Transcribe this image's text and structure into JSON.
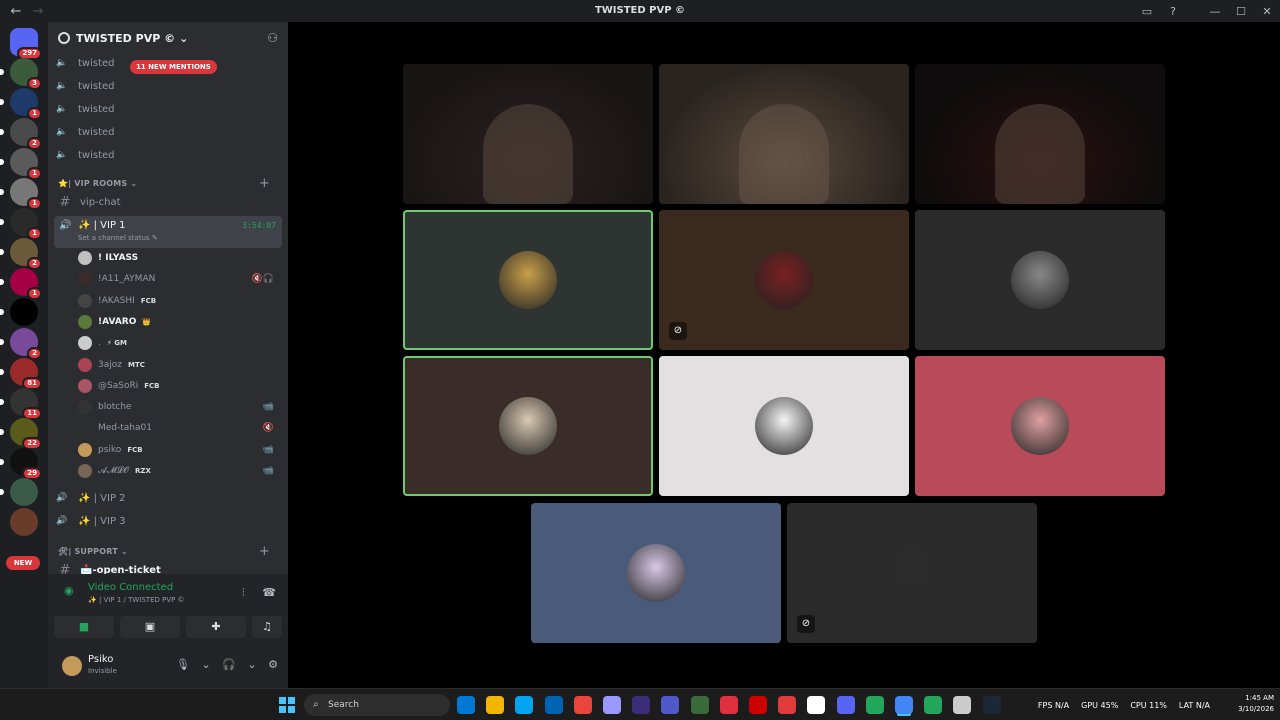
{
  "titlebar": {
    "title": "TWISTED PVP ©",
    "back": "←",
    "forward": "→"
  },
  "guild": {
    "name": "TWISTED PVP ©",
    "chevron": "⌄"
  },
  "servers": [
    {
      "badge": "297",
      "color": "#5865f2"
    },
    {
      "badge": "3",
      "color": "#3b5b3b"
    },
    {
      "badge": "1",
      "color": "#1e3a6a"
    },
    {
      "badge": "2",
      "color": "#4a4a4a"
    },
    {
      "badge": "1",
      "color": "#5a5a5a"
    },
    {
      "badge": "1",
      "color": "#777"
    },
    {
      "badge": "1",
      "color": "#2a2a2a"
    },
    {
      "badge": "2",
      "color": "#6a5a3a"
    },
    {
      "badge": "1",
      "color": "#a50044"
    },
    {
      "badge": "",
      "color": "#000000"
    },
    {
      "badge": "2",
      "color": "#7a4a9a"
    },
    {
      "badge": "81",
      "color": "#9a2a2a"
    },
    {
      "badge": "11",
      "color": "#333"
    },
    {
      "badge": "22",
      "color": "#5a5a1a"
    },
    {
      "badge": "29",
      "color": "#111"
    },
    {
      "badge": "",
      "color": "#3a5a4a"
    },
    {
      "badge": "",
      "color": "#6a3a2a"
    }
  ],
  "new_pill": "NEW",
  "top_voice_channels": [
    "twisted",
    "twisted",
    "twisted",
    "twisted",
    "twisted"
  ],
  "mentions_pill": "11 NEW MENTIONS",
  "categories": {
    "vip": "⭐| VIP ROOMS ⌄",
    "support": "🛠| SUPPORT ⌄"
  },
  "text_channels": {
    "vip_chat": "vip-chat",
    "open_ticket": "📩-open-ticket"
  },
  "vip1": {
    "name": "✨ | VIP 1",
    "timer": "3:54:07",
    "status": "Set a channel status ✎"
  },
  "members": [
    {
      "name": "! ILYASS",
      "tag": "",
      "icon": "",
      "color": "#c0c0c0",
      "bold": true
    },
    {
      "name": "!A11_AYMAN",
      "tag": "",
      "icon": "🔇🎧",
      "color": "#3a2a2a",
      "bold": false
    },
    {
      "name": "!AKASHI",
      "tag": "FCB",
      "icon": "",
      "color": "#444",
      "bold": false
    },
    {
      "name": "!AVARO",
      "tag": "👑",
      "icon": "",
      "color": "#5a7a3a",
      "bold": true
    },
    {
      "name": ".",
      "tag": "⚡ GM",
      "icon": "",
      "color": "#ccc",
      "bold": false
    },
    {
      "name": "3ajoz",
      "tag": "MTC",
      "icon": "",
      "color": "#aa4455",
      "bold": false
    },
    {
      "name": "@SaSoRi",
      "tag": "FCB",
      "icon": "",
      "color": "#aa5566",
      "bold": false
    },
    {
      "name": "blotche",
      "tag": "",
      "icon": "📹",
      "color": "#333",
      "bold": false
    },
    {
      "name": "Med-taha01",
      "tag": "",
      "icon": "🔇",
      "color": "#2b2d31",
      "bold": false
    },
    {
      "name": "psiko",
      "tag": "FCB",
      "icon": "📹",
      "color": "#c49a5a",
      "bold": false
    },
    {
      "name": "𝓐𝓜𝓛𝓞",
      "tag": "RZX",
      "icon": "📹",
      "color": "#776655",
      "bold": false
    }
  ],
  "other_voice": [
    "✨ | VIP 2",
    "✨ | VIP 3"
  ],
  "voice_panel": {
    "status": "Video Connected",
    "channel": "✨ | VIP 1 / TWISTED PVP ©"
  },
  "user": {
    "name": "Psiko",
    "status": "Invisible"
  },
  "tiles": [
    {
      "type": "video",
      "bg": "#1a1515",
      "accent": "#2a2020",
      "speaking": false,
      "muted": false
    },
    {
      "type": "video",
      "bg": "#2a2420",
      "accent": "#5a4a3a",
      "speaking": false,
      "muted": false
    },
    {
      "type": "video",
      "bg": "#0e0c0c",
      "accent": "#2a1010",
      "speaking": false,
      "muted": false
    },
    {
      "type": "avatar",
      "bg": "#2e3431",
      "avatar": "#c9a04a",
      "speaking": true,
      "muted": false
    },
    {
      "type": "avatar",
      "bg": "#3b2a1e",
      "avatar": "#7a2020",
      "speaking": false,
      "muted": true
    },
    {
      "type": "avatar",
      "bg": "#2b2b2b",
      "avatar": "#888888",
      "speaking": false,
      "muted": false
    },
    {
      "type": "avatar",
      "bg": "#3a2c28",
      "avatar": "#d8c8b0",
      "speaking": true,
      "muted": false
    },
    {
      "type": "avatar",
      "bg": "#e3e0e1",
      "avatar": "#f5f5f5",
      "speaking": false,
      "muted": false
    },
    {
      "type": "avatar",
      "bg": "#b84a59",
      "avatar": "#e0a0a0",
      "speaking": false,
      "muted": false
    },
    {
      "type": "avatar",
      "bg": "#4a5a7a",
      "avatar": "#d8c8e8",
      "speaking": false,
      "muted": false
    },
    {
      "type": "avatar",
      "bg": "#2b2b2b",
      "avatar": "#333333",
      "speaking": false,
      "muted": true
    }
  ],
  "taskbar": {
    "search": "Search",
    "apps": [
      "#0078d4",
      "#f2b600",
      "#00a4ef",
      "#0063b1",
      "#e8453c",
      "#9999ff",
      "#3b2d7a",
      "#5059c9",
      "#3a6a3a",
      "#e03040",
      "#c00",
      "#e03a3a",
      "#fff",
      "#5865f2",
      "#23a55a",
      "#4285f4",
      "#23a55a",
      "#ccc",
      "#1b2838"
    ],
    "tray": {
      "fps": "FPS N/A",
      "gpu": "GPU 45%",
      "cpu": "CPU 11%",
      "lat": "LAT N/A"
    },
    "clock_time": "1:45 AM",
    "clock_date": "3/10/2026"
  }
}
